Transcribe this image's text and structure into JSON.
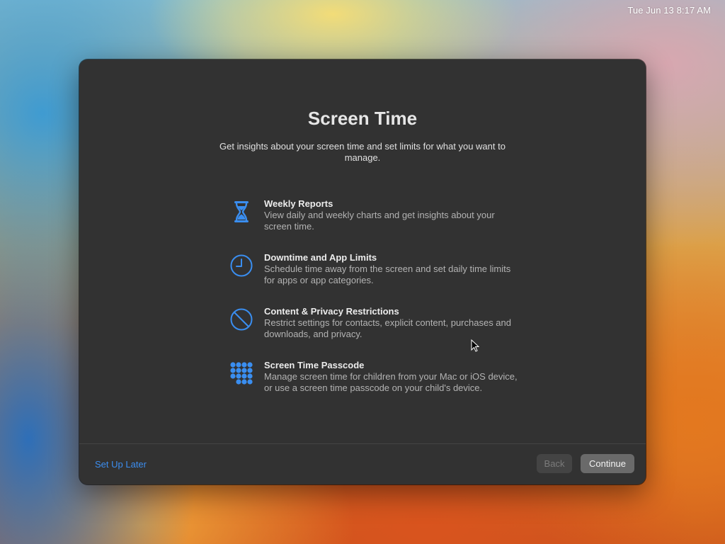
{
  "menubar": {
    "clock": "Tue Jun 13  8:17 AM"
  },
  "dialog": {
    "title": "Screen Time",
    "subtitle": "Get insights about your screen time and set limits for what you want to manage.",
    "features": [
      {
        "icon": "hourglass-icon",
        "title": "Weekly Reports",
        "description": "View daily and weekly charts and get insights about your screen time."
      },
      {
        "icon": "clock-icon",
        "title": "Downtime and App Limits",
        "description": "Schedule time away from the screen and set daily time limits for apps or app categories."
      },
      {
        "icon": "restriction-icon",
        "title": "Content & Privacy Restrictions",
        "description": "Restrict settings for contacts, explicit content, purchases and downloads, and privacy."
      },
      {
        "icon": "keypad-icon",
        "title": "Screen Time Passcode",
        "description": "Manage screen time for children from your Mac or iOS device, or use a screen time passcode on your child's device."
      }
    ],
    "footer": {
      "setup_later": "Set Up Later",
      "back": "Back",
      "continue": "Continue"
    }
  },
  "colors": {
    "accent": "#3c8ef0",
    "dialog_bg": "#323232"
  }
}
